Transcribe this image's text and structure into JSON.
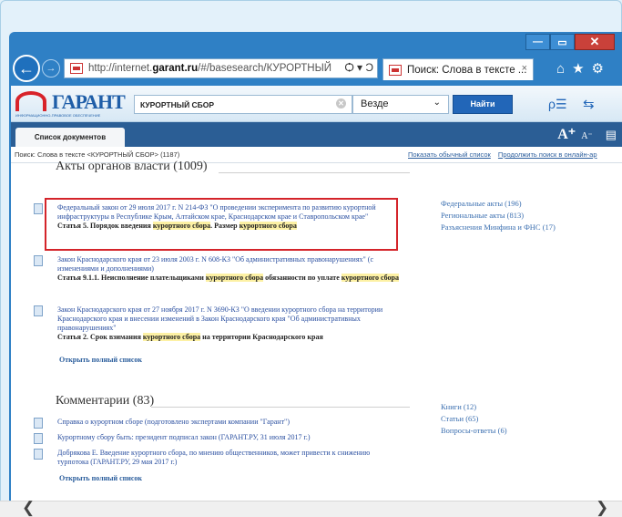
{
  "browser": {
    "url_prefix": "http://internet.",
    "url_host": "garant.ru",
    "url_suffix": "/#/basesearch/КУРОРТНЫЙ",
    "address_icons": "Ѻ ▾ Ͻ",
    "tab_title": "Поиск: Слова в тексте ...",
    "tab_close": "×",
    "back_glyph": "←",
    "forward_glyph": "→",
    "toolbar_glyphs": "⌂★⚙",
    "win_min": "—",
    "win_max": "▭",
    "win_close": "✕"
  },
  "garant": {
    "logo": "ГАРАНТ",
    "logo_sub": "ИНФОРМАЦИОННО-ПРАВОВОЕ ОБЕСПЕЧЕНИЕ",
    "search_value": "КУРОРТНЫЙ СБОР",
    "search_clear": "✕",
    "scope_value": "Везде",
    "scope_arrow": "⌄",
    "find_label": "Найти",
    "icon1": "ρ☰",
    "icon2": "⇆"
  },
  "tabs": {
    "doc_list_label": "Список документов",
    "font_big": "A⁺",
    "font_small": "A⁻",
    "print": "▤"
  },
  "query": {
    "text": "Поиск: Слова в тексте <КУРОРТНЫЙ СБОР> (1187)",
    "link1": "Показать обычный список",
    "link2": "Продолжить поиск в онлайн-ар"
  },
  "acts": {
    "title": "Акты органов власти (1009)",
    "items": [
      {
        "title": "Федеральный закон от 29 июля 2017 г. N 214-ФЗ \"О проведении эксперимента по развитию курортной инфраструктуры в Республике Крым, Алтайском крае, Краснодарском крае и Ставропольском крае\"",
        "snippet_a": "Статья 5. Порядок введения ",
        "snippet_hl1": "курортного сбора",
        "snippet_b": ". Размер ",
        "snippet_hl2": "курортного сбора"
      },
      {
        "title": "Закон Краснодарского края от 23 июля 2003 г. N 608-КЗ \"Об административных правонарушениях\" (с изменениями и дополнениями)",
        "snippet_a": "Статья 9.1.1. Неисполнение плательщиками ",
        "snippet_hl1": "курортного сбора",
        "snippet_b": " обязанности по уплате ",
        "snippet_hl2": "курортного сбора"
      },
      {
        "title": "Закон Краснодарского края от 27 ноября 2017 г. N 3690-КЗ \"О введении курортного сбора на территории Краснодарского края и внесении изменений в Закон Краснодарского края \"Об административных правонарушениях\"",
        "snippet_a": "Статья 2. Срок взимания ",
        "snippet_hl1": "курортного сбора",
        "snippet_b": " на территории Краснодарского края",
        "snippet_hl2": ""
      }
    ],
    "open_list": "Открыть полный список",
    "side": [
      "Федеральные акты (196)",
      "Региональные акты (813)",
      "Разъяснения Минфина и ФНС (17)"
    ]
  },
  "comments": {
    "title": "Комментарии (83)",
    "items": [
      "Справка о курортном сборе (подготовлено экспертами компании \"Гарант\")",
      "Курортному сбору быть: президент подписал закон (ГАРАНТ.РУ, 31 июля 2017 г.)",
      "Добрякова Е. Введение курортного сбора, по мнению общественников, может привести к снижению турпотока (ГАРАНТ.РУ, 29 мая 2017 г.)"
    ],
    "open_list": "Открыть полный список",
    "side": [
      "Книги (12)",
      "Статьи (65)",
      "Вопросы-ответы (6)"
    ]
  },
  "scroll": {
    "left": "❮",
    "right": "❯"
  }
}
